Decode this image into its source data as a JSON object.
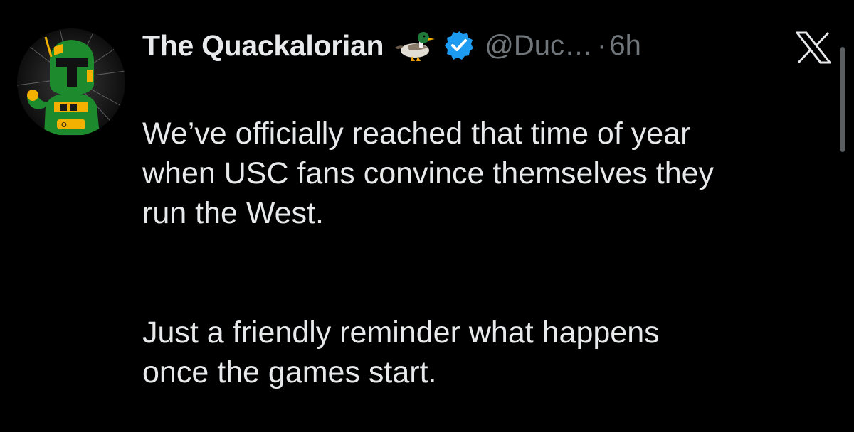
{
  "tweet": {
    "display_name": "The Quackalorian",
    "handle": "@Duc…",
    "separator": "·",
    "time": "6h",
    "paragraphs": [
      "We’ve officially reached that time of year\nwhen USC fans convince themselves they\nrun the West.",
      "Just a friendly reminder what happens\nonce the games start."
    ]
  },
  "icons": {
    "name_emoji": "duck-icon",
    "badge": "verified-badge-icon",
    "platform": "x-logo-icon"
  },
  "colors": {
    "background": "#000000",
    "primary_text": "#e7e9ea",
    "secondary_text": "#71767b",
    "verified_blue": "#1d9bf0",
    "avatar_green": "#1e8a2e",
    "avatar_gold": "#f2b100"
  }
}
